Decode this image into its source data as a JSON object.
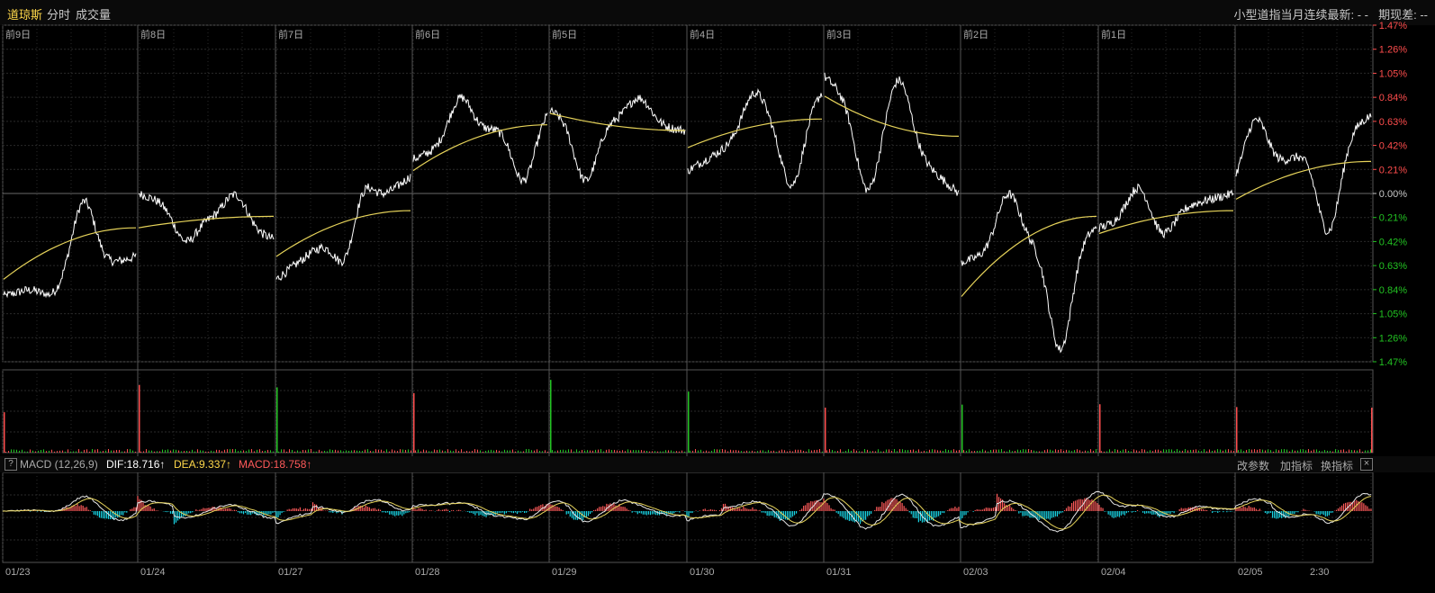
{
  "header": {
    "name": "道琼斯",
    "tab1": "分时",
    "tab2": "成交量",
    "right1": "小型道指当月连续最新: - -",
    "right2": "期现差: --"
  },
  "day_labels": [
    "前9日",
    "前8日",
    "前7日",
    "前6日",
    "前5日",
    "前4日",
    "前3日",
    "前2日",
    "前1日"
  ],
  "pct_labels": [
    "1.47%",
    "1.26%",
    "1.05%",
    "0.84%",
    "0.63%",
    "0.42%",
    "0.21%",
    "0.00%",
    "0.21%",
    "0.42%",
    "0.63%",
    "0.84%",
    "1.05%",
    "1.26%",
    "1.47%"
  ],
  "date_labels": [
    "01/23",
    "01/24",
    "01/27",
    "01/28",
    "01/29",
    "01/30",
    "01/31",
    "02/03",
    "02/04",
    "02/05",
    "2:30"
  ],
  "macd": {
    "help": "?",
    "name": "MACD (12,26,9)",
    "dif": "DIF:18.716↑",
    "dea": "DEA:9.337↑",
    "macd": "MACD:18.758↑",
    "btn_params": "改参数",
    "btn_add": "加指标",
    "btn_switch": "换指标",
    "close": "×"
  },
  "colors": {
    "up": "#ff4d4d",
    "down": "#22c322",
    "price": "#ffffff",
    "avg": "#e6d35a",
    "macd_pos": "#ff5a5a",
    "macd_neg": "#19d6e6",
    "grid": "#2a2a2a",
    "sep": "#555555"
  },
  "chart_data": {
    "type": "line",
    "title": "",
    "xlabel": "",
    "ylabel": "",
    "ylim": [
      -1.47,
      1.47
    ],
    "days": [
      {
        "date": "01/23",
        "label": "前9日",
        "open": -0.9,
        "close": -0.55,
        "high": 0.0,
        "low": -0.9,
        "avg_start": -0.75,
        "avg_end": -0.3
      },
      {
        "date": "01/24",
        "label": "前8日",
        "open": 0.0,
        "close": -0.4,
        "high": 0.02,
        "low": -0.45,
        "avg_start": -0.3,
        "avg_end": -0.2
      },
      {
        "date": "01/27",
        "label": "前7日",
        "open": -0.75,
        "close": 0.15,
        "high": 0.25,
        "low": -0.8,
        "avg_start": -0.55,
        "avg_end": -0.15
      },
      {
        "date": "01/28",
        "label": "前6日",
        "open": 0.3,
        "close": 0.75,
        "high": 0.88,
        "low": 0.05,
        "avg_start": 0.2,
        "avg_end": 0.6
      },
      {
        "date": "01/29",
        "label": "前5日",
        "open": 0.72,
        "close": 0.55,
        "high": 0.86,
        "low": 0.05,
        "avg_start": 0.7,
        "avg_end": 0.55
      },
      {
        "date": "01/30",
        "label": "前4日",
        "open": 0.2,
        "close": 0.9,
        "high": 0.92,
        "low": 0.0,
        "avg_start": 0.4,
        "avg_end": 0.65
      },
      {
        "date": "01/31",
        "label": "前3日",
        "open": 1.02,
        "close": 0.0,
        "high": 1.06,
        "low": -0.05,
        "avg_start": 0.85,
        "avg_end": 0.5
      },
      {
        "date": "02/03",
        "label": "前2日",
        "open": -0.6,
        "close": -0.3,
        "high": 0.05,
        "low": -1.47,
        "avg_start": -0.9,
        "avg_end": -0.2
      },
      {
        "date": "02/04",
        "label": "前1日",
        "open": -0.3,
        "close": 0.0,
        "high": 0.1,
        "low": -0.4,
        "avg_start": -0.35,
        "avg_end": -0.15
      },
      {
        "date": "02/05",
        "label": "",
        "open": 0.05,
        "close": 0.68,
        "high": 0.7,
        "low": -0.42,
        "avg_start": -0.05,
        "avg_end": 0.28
      }
    ]
  }
}
